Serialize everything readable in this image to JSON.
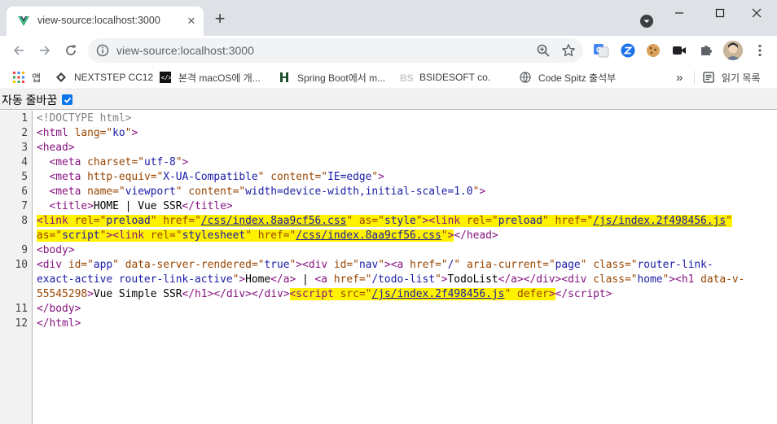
{
  "tab": {
    "title": "view-source:localhost:3000",
    "close": "✕"
  },
  "window": {
    "minimize": "—",
    "maximize": "☐",
    "close": "✕",
    "new_tab": "+"
  },
  "omnibox": {
    "url": "view-source:localhost:3000"
  },
  "bookmarks": {
    "apps": "앱",
    "items": [
      {
        "label": "NEXTSTEP CC12",
        "icon": "diamond-icon"
      },
      {
        "label": "본격 macOS에 개...",
        "icon": "code-icon"
      },
      {
        "label": "Spring Boot에서 m...",
        "icon": "bar-icon"
      },
      {
        "label": "BSIDESOFT co.",
        "icon": "bs-logo-icon"
      },
      {
        "label": "Code Spitz 출석부",
        "icon": "globe-icon"
      }
    ],
    "more": "»",
    "reading_list": "읽기 목록"
  },
  "wrap": {
    "label": "자동 줄바꿈",
    "checked": true
  },
  "source": {
    "line_numbers": [
      "1",
      "2",
      "3",
      "4",
      "5",
      "6",
      "7",
      "8",
      "",
      "9",
      "10",
      "",
      "",
      "11",
      "12"
    ],
    "doctype": "<!DOCTYPE html>",
    "html_tag": "html",
    "lang_attr": "lang",
    "lang_val": "ko",
    "head_tag": "head",
    "meta_tag": "meta",
    "charset_attr": "charset",
    "charset_val": "utf-8",
    "http_equiv_attr": "http-equiv",
    "http_equiv_val": "X-UA-Compatible",
    "content_attr": "content",
    "content_edge_val": "IE=edge",
    "name_attr": "name",
    "viewport_val": "viewport",
    "viewport_content_val": "width=device-width,initial-scale=1.0",
    "title_tag": "title",
    "title_text": "HOME | Vue SSR",
    "link_tag": "link",
    "rel_attr": "rel",
    "preload_val": "preload",
    "href_attr": "href",
    "css_href": "/css/index.8aa9cf56.css",
    "js_href": "/js/index.2f498456.js",
    "as_attr": "as",
    "style_val": "style",
    "script_val": "script",
    "stylesheet_val": "stylesheet",
    "body_tag": "body",
    "div_tag": "div",
    "id_attr": "id",
    "app_val": "app",
    "ssr_attr": "data-server-rendered",
    "true_val": "true",
    "nav_val": "nav",
    "a_tag": "a",
    "root_href": "/",
    "aria_attr": "aria-current",
    "page_val": "page",
    "class_attr": "class",
    "router_link_val_1": "router-link-",
    "router_link_val_2": "exact-active router-link-active",
    "home_text": "Home",
    "sep_text": " | ",
    "todo_href": "/todo-list",
    "todolist_text": "TodoList",
    "home_class_val": "home",
    "h1_tag": "h1",
    "data_v_attr_1": "data-v-",
    "data_v_attr_2": "55545298",
    "h1_text": "Vue Simple SSR",
    "script_tag": "script",
    "src_attr": "src",
    "defer_attr": "defer"
  }
}
